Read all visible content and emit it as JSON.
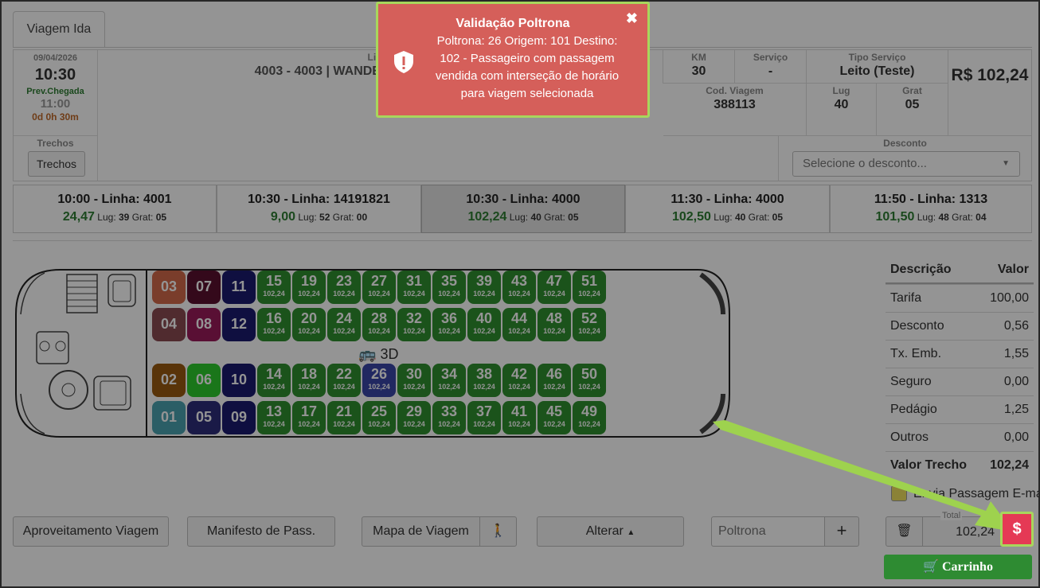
{
  "tab": {
    "label": "Viagem Ida"
  },
  "trip_info": {
    "date": "09/04/2026",
    "time": "10:30",
    "prev_label": "Prev.Chegada",
    "arrival": "11:00",
    "duration": "0d 0h 30m",
    "linha_label": "Linha",
    "linha_value": "4003 - 4003 | WANDEX - LINHAS 4000 - T3",
    "km_label": "KM",
    "km_value": "30",
    "servico_label": "Serviço",
    "servico_value": "-",
    "tipo_label": "Tipo Serviço",
    "tipo_value": "Leito (Teste)",
    "cod_label": "Cod. Viagem",
    "cod_value": "388113",
    "lug_label": "Lug",
    "lug_value": "40",
    "grat_label": "Grat",
    "grat_value": "05",
    "price": "R$ 102,24",
    "trechos_label": "Trechos",
    "trechos_button": "Trechos",
    "desconto_label": "Desconto",
    "desconto_placeholder": "Selecione o desconto..."
  },
  "trips": [
    {
      "title": "10:00 - Linha: 4001",
      "price": "24,47",
      "lug_label": "Lug:",
      "lug": "39",
      "grat_label": "Grat:",
      "grat": "05"
    },
    {
      "title": "10:30 - Linha: 14191821",
      "price": "9,00",
      "lug_label": "Lug:",
      "lug": "52",
      "grat_label": "Grat:",
      "grat": "00"
    },
    {
      "title": "10:30 - Linha: 4000",
      "price": "102,24",
      "lug_label": "Lug:",
      "lug": "40",
      "grat_label": "Grat:",
      "grat": "05"
    },
    {
      "title": "11:30 - Linha: 4000",
      "price": "102,50",
      "lug_label": "Lug:",
      "lug": "40",
      "grat_label": "Grat:",
      "grat": "05"
    },
    {
      "title": "11:50 - Linha: 1313",
      "price": "101,50",
      "lug_label": "Lug:",
      "lug": "48",
      "grat_label": "Grat:",
      "grat": "04"
    }
  ],
  "bus_label": "3D",
  "seat_price": "102,24",
  "seats": {
    "top_row": [
      "03",
      "07",
      "11",
      "15",
      "19",
      "23",
      "27",
      "31",
      "35",
      "39",
      "43",
      "47",
      "51"
    ],
    "second_row": [
      "04",
      "08",
      "12",
      "16",
      "20",
      "24",
      "28",
      "32",
      "36",
      "40",
      "44",
      "48",
      "52"
    ],
    "third_row": [
      "02",
      "06",
      "10",
      "14",
      "18",
      "22",
      "26",
      "30",
      "34",
      "38",
      "42",
      "46",
      "50"
    ],
    "bottom_row": [
      "01",
      "05",
      "09",
      "13",
      "17",
      "21",
      "25",
      "29",
      "33",
      "37",
      "41",
      "45",
      "49"
    ]
  },
  "colors": {
    "available": "#2f8f2f",
    "selected": "#3a46a8",
    "navy": "#1a1a6e",
    "s03": "#d26a4a",
    "s04": "#8a4a52",
    "s07": "#5a1030",
    "s08": "#9a1a5a",
    "s02": "#9a5a10",
    "s06": "#2ecc2e",
    "s01": "#4aa3b0",
    "s05": "#2e2e7a"
  },
  "fare": {
    "header_desc": "Descrição",
    "header_val": "Valor",
    "rows": [
      {
        "label": "Tarifa",
        "value": "100,00"
      },
      {
        "label": "Desconto",
        "value": "0,56"
      },
      {
        "label": "Tx. Emb.",
        "value": "1,55"
      },
      {
        "label": "Seguro",
        "value": "0,00"
      },
      {
        "label": "Pedágio",
        "value": "1,25"
      },
      {
        "label": "Outros",
        "value": "0,00"
      }
    ],
    "total_label": "Valor Trecho",
    "total_value": "102,24"
  },
  "email_label": "Envia Passagem E-ma",
  "total_label": "Total",
  "total_value": "102,24",
  "buttons": {
    "aproveitamento": "Aproveitamento Viagem",
    "manifesto": "Manifesto de Pass.",
    "mapa": "Mapa de Viagem",
    "alterar": "Alterar",
    "poltrona_placeholder": "Poltrona",
    "add": "+",
    "pay": "$",
    "cart": "Carrinho"
  },
  "toast": {
    "title": "Validação Poltrona",
    "message": "Poltrona: 26 Origem: 101 Destino: 102 - Passageiro com passagem vendida com interseção de horário para viagem selecionada",
    "close": "✖"
  }
}
